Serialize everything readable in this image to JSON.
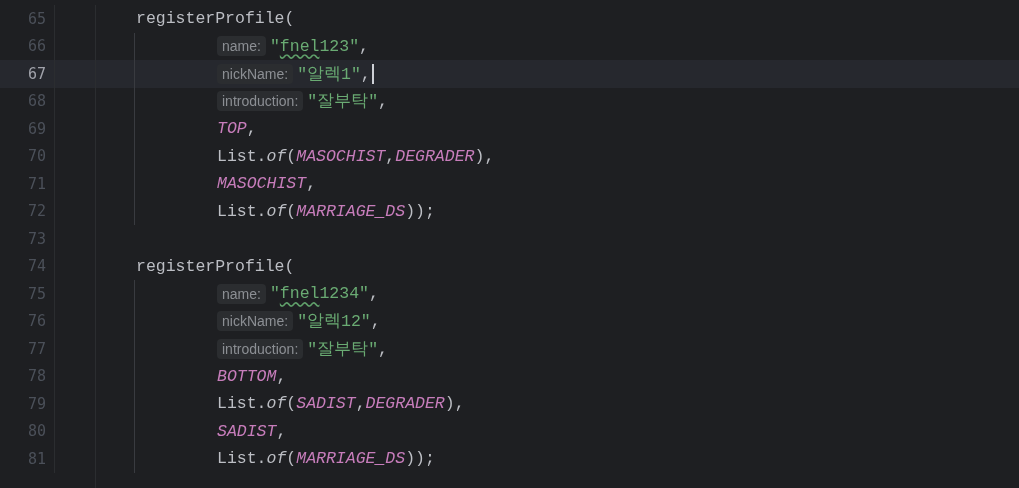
{
  "editor": {
    "lines": [
      {
        "number": "65",
        "kind": "statement",
        "current": false,
        "tokens": [
          {
            "kind": "plain",
            "text": "registerProfile("
          }
        ]
      },
      {
        "number": "66",
        "kind": "argument",
        "current": false,
        "tokens": [
          {
            "kind": "hint",
            "text": "name:"
          },
          {
            "kind": "string",
            "text": "\""
          },
          {
            "kind": "string-typo",
            "text": "fnel"
          },
          {
            "kind": "string",
            "text": "123\""
          },
          {
            "kind": "plain",
            "text": ","
          }
        ]
      },
      {
        "number": "67",
        "kind": "argument",
        "current": true,
        "tokens": [
          {
            "kind": "hint",
            "text": "nickName:"
          },
          {
            "kind": "string",
            "text": "\"알렉1\""
          },
          {
            "kind": "plain",
            "text": ","
          }
        ]
      },
      {
        "number": "68",
        "kind": "argument",
        "current": false,
        "tokens": [
          {
            "kind": "hint",
            "text": "introduction:"
          },
          {
            "kind": "string",
            "text": "\"잘부탁\""
          },
          {
            "kind": "plain",
            "text": ","
          }
        ]
      },
      {
        "number": "69",
        "kind": "argument",
        "current": false,
        "tokens": [
          {
            "kind": "constant",
            "text": "TOP"
          },
          {
            "kind": "plain",
            "text": ","
          }
        ]
      },
      {
        "number": "70",
        "kind": "argument",
        "current": false,
        "tokens": [
          {
            "kind": "plain",
            "text": "List."
          },
          {
            "kind": "method",
            "text": "of"
          },
          {
            "kind": "plain",
            "text": "("
          },
          {
            "kind": "constant",
            "text": "MASOCHIST"
          },
          {
            "kind": "plain",
            "text": ","
          },
          {
            "kind": "constant",
            "text": "DEGRADER"
          },
          {
            "kind": "plain",
            "text": "),"
          }
        ]
      },
      {
        "number": "71",
        "kind": "argument",
        "current": false,
        "tokens": [
          {
            "kind": "constant",
            "text": "MASOCHIST"
          },
          {
            "kind": "plain",
            "text": ","
          }
        ]
      },
      {
        "number": "72",
        "kind": "argument",
        "current": false,
        "tokens": [
          {
            "kind": "plain",
            "text": "List."
          },
          {
            "kind": "method",
            "text": "of"
          },
          {
            "kind": "plain",
            "text": "("
          },
          {
            "kind": "constant",
            "text": "MARRIAGE_DS"
          },
          {
            "kind": "plain",
            "text": "));"
          }
        ]
      },
      {
        "number": "73",
        "kind": "blank",
        "current": false
      },
      {
        "number": "74",
        "kind": "statement",
        "current": false,
        "tokens": [
          {
            "kind": "plain",
            "text": "registerProfile("
          }
        ]
      },
      {
        "number": "75",
        "kind": "argument",
        "current": false,
        "tokens": [
          {
            "kind": "hint",
            "text": "name:"
          },
          {
            "kind": "string",
            "text": "\""
          },
          {
            "kind": "string-typo",
            "text": "fnel"
          },
          {
            "kind": "string",
            "text": "1234\""
          },
          {
            "kind": "plain",
            "text": ","
          }
        ]
      },
      {
        "number": "76",
        "kind": "argument",
        "current": false,
        "tokens": [
          {
            "kind": "hint",
            "text": "nickName:"
          },
          {
            "kind": "string",
            "text": "\"알렉12\""
          },
          {
            "kind": "plain",
            "text": ","
          }
        ]
      },
      {
        "number": "77",
        "kind": "argument",
        "current": false,
        "tokens": [
          {
            "kind": "hint",
            "text": "introduction:"
          },
          {
            "kind": "string",
            "text": "\"잘부탁\""
          },
          {
            "kind": "plain",
            "text": ","
          }
        ]
      },
      {
        "number": "78",
        "kind": "argument",
        "current": false,
        "tokens": [
          {
            "kind": "constant",
            "text": "BOTTOM"
          },
          {
            "kind": "plain",
            "text": ","
          }
        ]
      },
      {
        "number": "79",
        "kind": "argument",
        "current": false,
        "tokens": [
          {
            "kind": "plain",
            "text": "List."
          },
          {
            "kind": "method",
            "text": "of"
          },
          {
            "kind": "plain",
            "text": "("
          },
          {
            "kind": "constant",
            "text": "SADIST"
          },
          {
            "kind": "plain",
            "text": ","
          },
          {
            "kind": "constant",
            "text": "DEGRADER"
          },
          {
            "kind": "plain",
            "text": "),"
          }
        ]
      },
      {
        "number": "80",
        "kind": "argument",
        "current": false,
        "tokens": [
          {
            "kind": "constant",
            "text": "SADIST"
          },
          {
            "kind": "plain",
            "text": ","
          }
        ]
      },
      {
        "number": "81",
        "kind": "argument",
        "current": false,
        "tokens": [
          {
            "kind": "plain",
            "text": "List."
          },
          {
            "kind": "method",
            "text": "of"
          },
          {
            "kind": "plain",
            "text": "("
          },
          {
            "kind": "constant",
            "text": "MARRIAGE_DS"
          },
          {
            "kind": "plain",
            "text": "));"
          }
        ]
      }
    ]
  }
}
